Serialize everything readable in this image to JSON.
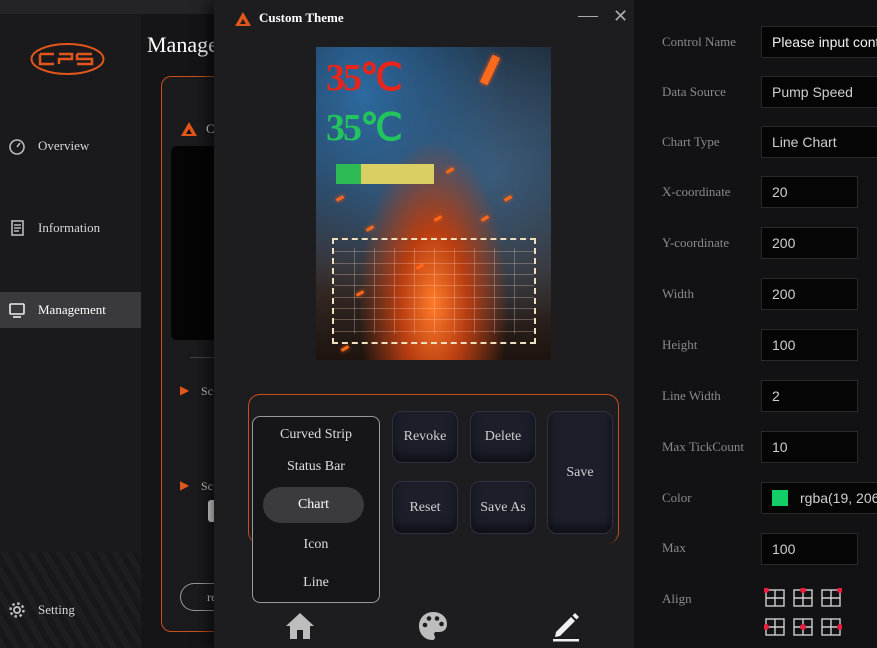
{
  "sidebar": {
    "logo_text": "CPS",
    "items": [
      {
        "label": "Overview",
        "icon": "speedometer-icon"
      },
      {
        "label": "Information",
        "icon": "document-icon"
      },
      {
        "label": "Management",
        "icon": "monitor-icon",
        "active": true
      }
    ],
    "setting_label": "Setting"
  },
  "background": {
    "title": "Manage",
    "card_prefix": "C",
    "section_a": "Sc",
    "section_b": "Sc",
    "pill_text": "re"
  },
  "dialog": {
    "title": "Custom Theme",
    "preview": {
      "temperature_red": "35℃",
      "temperature_green": "35℃",
      "status_bar_fill_fraction": 0.25,
      "colors": {
        "red": "#e8251a",
        "green": "#22c45e",
        "bar_fill": "#2dbb55",
        "bar_track": "#d9cf63"
      }
    },
    "buttons": {
      "revoke": "Revoke",
      "delete": "Delete",
      "save": "Save",
      "reset": "Reset",
      "save_as": "Save As"
    },
    "element_menu": [
      "Curved Strip",
      "Status Bar",
      "Chart",
      "Icon",
      "Line"
    ],
    "element_menu_selected": "Chart",
    "bottom_tabs": [
      "home-icon",
      "palette-icon",
      "pen-icon"
    ],
    "accent_color": "#c8501d"
  },
  "properties": {
    "control_name": {
      "label": "Control Name",
      "placeholder": "Please input cont"
    },
    "data_source": {
      "label": "Data Source",
      "value": "Pump Speed"
    },
    "chart_type": {
      "label": "Chart Type",
      "value": "Line Chart"
    },
    "x_coordinate": {
      "label": "X-coordinate",
      "value": "20"
    },
    "y_coordinate": {
      "label": "Y-coordinate",
      "value": "200"
    },
    "width": {
      "label": "Width",
      "value": "200"
    },
    "height": {
      "label": "Height",
      "value": "100"
    },
    "line_width": {
      "label": "Line Width",
      "value": "2"
    },
    "max_tick_count": {
      "label": "Max TickCount",
      "value": "10"
    },
    "color": {
      "label": "Color",
      "value": "rgba(19, 206",
      "swatch": "#13ce66"
    },
    "max": {
      "label": "Max",
      "value": "100"
    },
    "align": {
      "label": "Align"
    }
  }
}
